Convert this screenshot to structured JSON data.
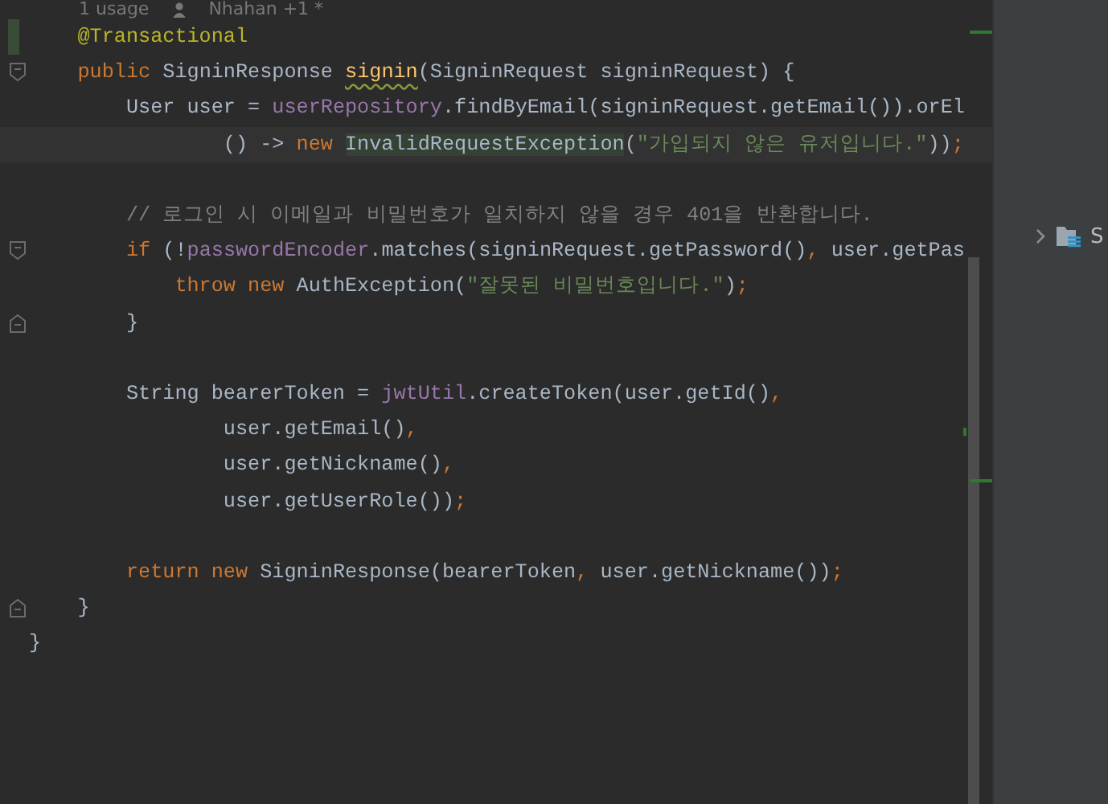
{
  "editor": {
    "inlay_hint": {
      "usages": "1 usage",
      "author": "Nhahan +1 *"
    },
    "lines": [
      {
        "changed": true,
        "tokens": [
          {
            "text": "    @Transactional",
            "kind": "annotation"
          }
        ]
      },
      {
        "fold_start": true,
        "tokens": [
          {
            "text": "    public ",
            "kind": "keyword"
          },
          {
            "text": "SigninResponse ",
            "kind": "plain"
          },
          {
            "text": "signin",
            "kind": "method_warning"
          },
          {
            "text": "(SigninRequest signinRequest) {",
            "kind": "plain"
          }
        ]
      },
      {
        "tokens": [
          {
            "text": "        User user = ",
            "kind": "plain"
          },
          {
            "text": "userRepository",
            "kind": "field"
          },
          {
            "text": ".findByEmail(signinRequest.getEmail()).orEl",
            "kind": "plain"
          }
        ]
      },
      {
        "current": true,
        "tokens": [
          {
            "text": "                () -> ",
            "kind": "plain"
          },
          {
            "text": "new ",
            "kind": "keyword"
          },
          {
            "text": "InvalidRequestException",
            "kind": "usage_highlight"
          },
          {
            "text": "(",
            "kind": "plain"
          },
          {
            "text": "\"가입되지 않은 유저입니다.\"",
            "kind": "string"
          },
          {
            "text": "))",
            "kind": "plain"
          },
          {
            "text": ";",
            "kind": "punct"
          }
        ]
      },
      {
        "blank_line_before": true,
        "tokens": [
          {
            "text": "        // 로그인 시 이메일과 비밀번호가 일치하지 않을 경우 401을 반환합니다.",
            "kind": "comment"
          }
        ]
      },
      {
        "fold_start": true,
        "tokens": [
          {
            "text": "        if ",
            "kind": "keyword"
          },
          {
            "text": "(!",
            "kind": "plain"
          },
          {
            "text": "passwordEncoder",
            "kind": "field"
          },
          {
            "text": ".matches(signinRequest.getPassword()",
            "kind": "plain"
          },
          {
            "text": ", ",
            "kind": "punct"
          },
          {
            "text": "user.getPas",
            "kind": "plain"
          }
        ]
      },
      {
        "tokens": [
          {
            "text": "            throw new ",
            "kind": "keyword"
          },
          {
            "text": "AuthException(",
            "kind": "plain"
          },
          {
            "text": "\"잘못된 비밀번호입니다.\"",
            "kind": "string"
          },
          {
            "text": ")",
            "kind": "plain"
          },
          {
            "text": ";",
            "kind": "punct"
          }
        ]
      },
      {
        "fold_end": true,
        "tokens": [
          {
            "text": "        }",
            "kind": "plain"
          }
        ]
      },
      {
        "blank_line_before": true,
        "tokens": [
          {
            "text": "        String bearerToken = ",
            "kind": "plain"
          },
          {
            "text": "jwtUtil",
            "kind": "field"
          },
          {
            "text": ".createToken(user.getId()",
            "kind": "plain"
          },
          {
            "text": ",",
            "kind": "punct"
          }
        ]
      },
      {
        "tokens": [
          {
            "text": "                user.getEmail()",
            "kind": "plain"
          },
          {
            "text": ",",
            "kind": "punct"
          }
        ]
      },
      {
        "tokens": [
          {
            "text": "                user.getNickname()",
            "kind": "plain"
          },
          {
            "text": ",",
            "kind": "punct"
          }
        ]
      },
      {
        "tokens": [
          {
            "text": "                user.getUserRole())",
            "kind": "plain"
          },
          {
            "text": ";",
            "kind": "punct"
          }
        ]
      },
      {
        "blank_line_before": true,
        "tokens": [
          {
            "text": "        return new ",
            "kind": "keyword"
          },
          {
            "text": "SigninResponse(bearerToken",
            "kind": "plain"
          },
          {
            "text": ", ",
            "kind": "punct"
          },
          {
            "text": "user.getNickname())",
            "kind": "plain"
          },
          {
            "text": ";",
            "kind": "punct"
          }
        ]
      },
      {
        "fold_end": true,
        "tokens": [
          {
            "text": "    }",
            "kind": "plain"
          }
        ]
      },
      {
        "tokens": [
          {
            "text": "}",
            "kind": "plain"
          }
        ]
      }
    ]
  },
  "project_panel": {
    "items": [
      {
        "label": "S",
        "expanded": false
      }
    ]
  }
}
